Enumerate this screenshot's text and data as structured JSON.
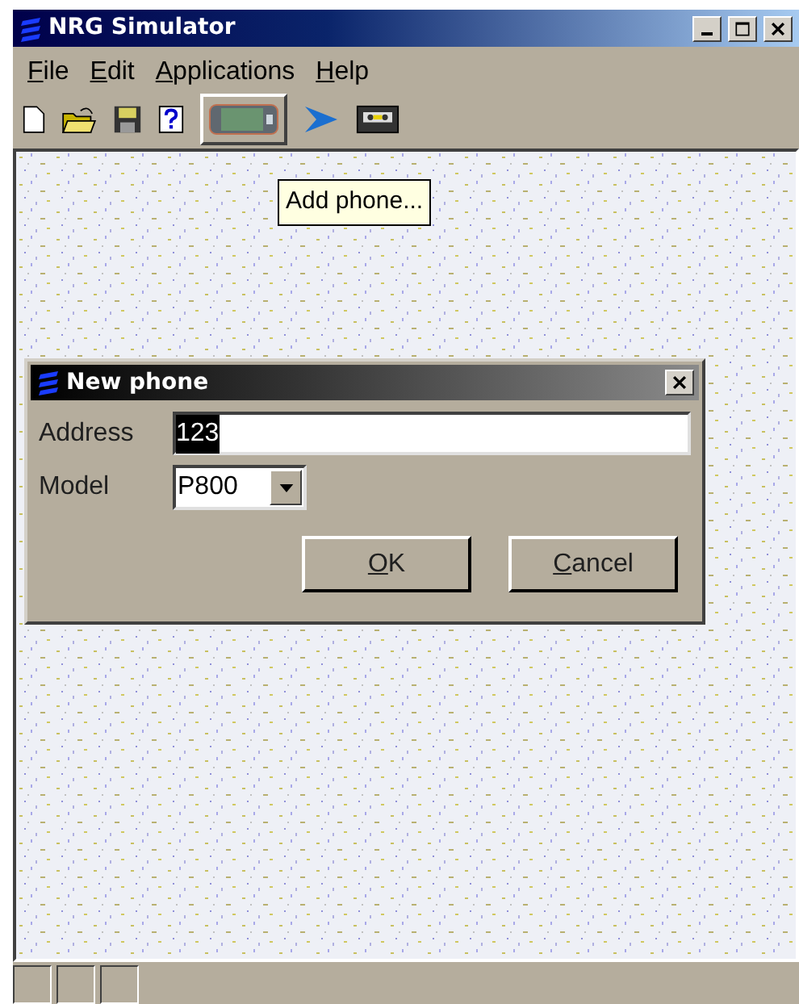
{
  "window": {
    "title": "NRG Simulator",
    "active": true
  },
  "menu": [
    {
      "label": "File",
      "underline_first": true
    },
    {
      "label": "Edit",
      "underline_first": true
    },
    {
      "label": "Applications",
      "underline_first": true
    },
    {
      "label": "Help",
      "underline_first": true
    }
  ],
  "toolbar": [
    {
      "kind": "new",
      "raised": false
    },
    {
      "kind": "open",
      "raised": false
    },
    {
      "kind": "save",
      "raised": false
    },
    {
      "kind": "help",
      "raised": false
    },
    {
      "kind": "phone",
      "raised": true
    },
    {
      "kind": "arrow",
      "raised": false
    },
    {
      "kind": "tape",
      "raised": false
    }
  ],
  "tooltip": "Add phone...",
  "dialog": {
    "title": "New phone",
    "fields": [
      {
        "kind": "text",
        "label": "Address",
        "value": "123",
        "selected": true
      },
      {
        "kind": "combo",
        "label": "Model",
        "value": "P800"
      }
    ],
    "buttons": [
      {
        "label": "OK",
        "underline_first": true
      },
      {
        "label": "Cancel",
        "underline_first": true
      }
    ]
  },
  "status_bar": [
    {
      "kind": "panel"
    },
    {
      "kind": "panel"
    },
    {
      "kind": "panel"
    }
  ]
}
